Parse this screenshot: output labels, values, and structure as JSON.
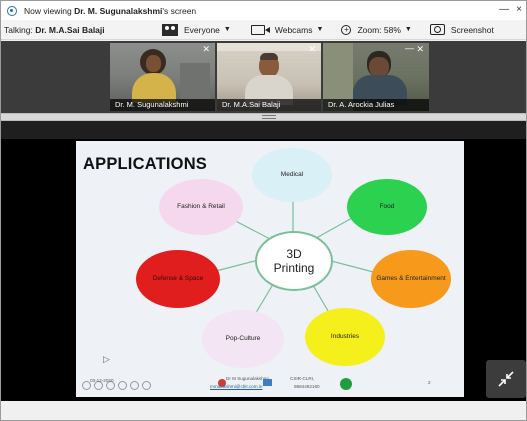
{
  "titlebar": {
    "prefix": "Now viewing ",
    "presenter": "Dr. M. Sugunalakshmi",
    "suffix": "'s screen",
    "minimize": "—",
    "close": "×"
  },
  "toolbar": {
    "talking_label": "Talking: ",
    "talking_name": "Dr. M.A.Sai Balaji",
    "audience": "Everyone",
    "webcams": "Webcams",
    "zoom": "Zoom: 58%",
    "screenshot": "Screenshot"
  },
  "participants": [
    {
      "name": "Dr. M. Sugunalakshmi"
    },
    {
      "name": "Dr. M.A.Sai Balaji"
    },
    {
      "name": "Dr. A. Arockia Julias"
    }
  ],
  "slide": {
    "title": "APPLICATIONS",
    "center": "3D Printing",
    "bubbles": [
      {
        "label": "Medical",
        "color": "#d9f0f6"
      },
      {
        "label": "Food",
        "color": "#2bd14f"
      },
      {
        "label": "Games & Entertainment",
        "color": "#f79a1c"
      },
      {
        "label": "Industries",
        "color": "#f5ef1b"
      },
      {
        "label": "Pop-Culture",
        "color": "#f3e5f3"
      },
      {
        "label": "Defense & Space",
        "color": "#e01e1e"
      },
      {
        "label": "Fashion & Retail",
        "color": "#f6d8ee"
      }
    ],
    "footer": {
      "date": "03-12-2020",
      "author": "Dr M Sugunalakshmi,",
      "email": "mmalakshmi@cbit.com.in",
      "org": "CSIR-CLRI,",
      "phone": "9884492160",
      "page": "2"
    }
  },
  "colors": {
    "accent_green": "#7bbf9a",
    "share_bg": "#000000"
  }
}
